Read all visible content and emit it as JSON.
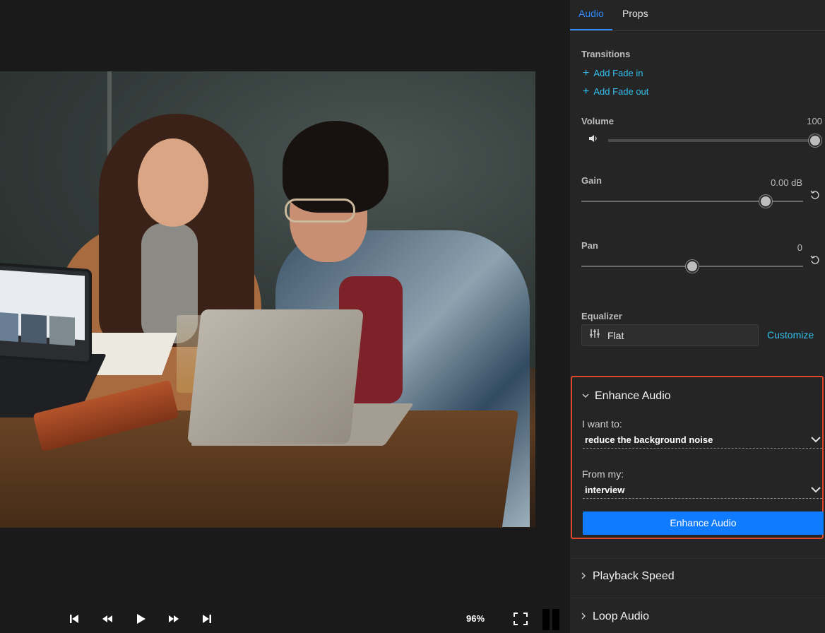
{
  "tabs": {
    "audio": "Audio",
    "props": "Props"
  },
  "transitions": {
    "label": "Transitions",
    "add_fade_in": "Add Fade in",
    "add_fade_out": "Add Fade out"
  },
  "volume": {
    "label": "Volume",
    "value": "100",
    "level": 1.0
  },
  "gain": {
    "label": "Gain",
    "value": "0.00 dB",
    "level": 0.85
  },
  "pan": {
    "label": "Pan",
    "value": "0",
    "level": 0.5
  },
  "equalizer": {
    "label": "Equalizer",
    "preset": "Flat",
    "customize": "Customize"
  },
  "enhance": {
    "title": "Enhance Audio",
    "want_label": "I want to:",
    "want_value": "reduce the background noise",
    "from_label": "From my:",
    "from_value": "interview",
    "button": "Enhance Audio"
  },
  "sections": {
    "playback_speed": "Playback Speed",
    "loop_audio": "Loop Audio"
  },
  "player": {
    "zoom": "96%"
  },
  "colors": {
    "accent": "#2f8bff",
    "link": "#33c0ee",
    "highlight_border": "#e2462a",
    "primary_button": "#0f7bff"
  },
  "icons": {
    "skip_start": "skip-to-start-icon",
    "rewind": "rewind-icon",
    "play": "play-icon",
    "fast_forward": "fast-forward-icon",
    "skip_end": "skip-to-end-icon",
    "fullscreen": "fullscreen-icon",
    "volume": "speaker-icon",
    "reset": "reset-icon",
    "equalizer": "equalizer-icon",
    "chevron": "chevron-icon"
  }
}
